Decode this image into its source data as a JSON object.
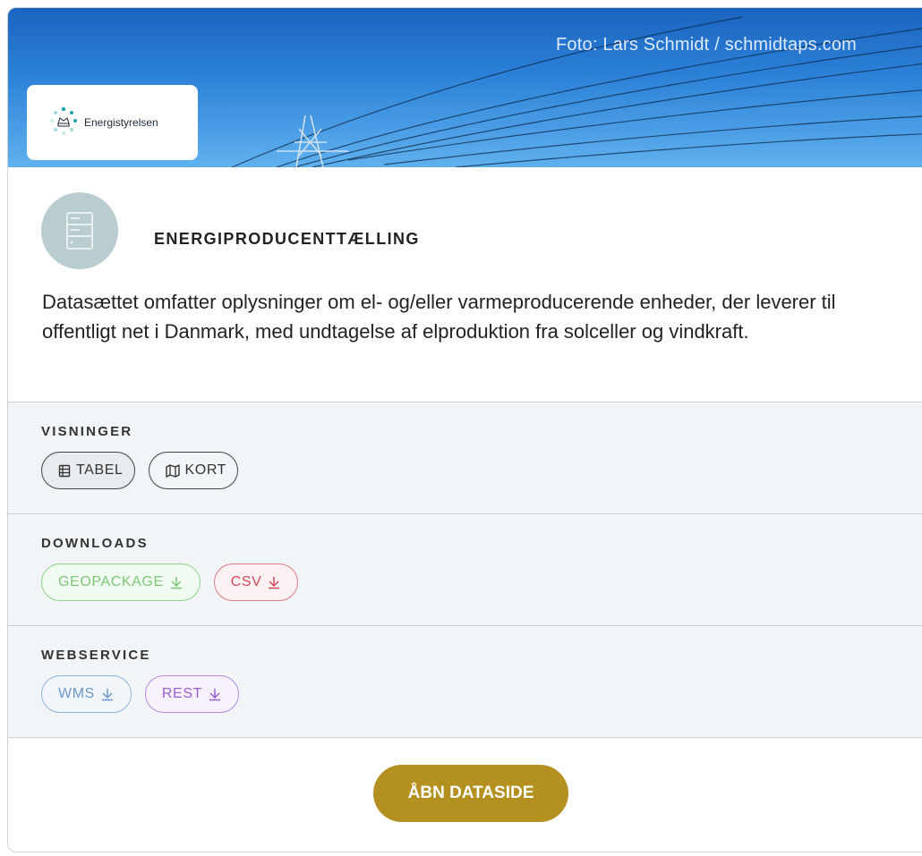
{
  "hero": {
    "photo_credit": "Foto: Lars Schmidt / schmidtaps.com",
    "logo_text": "Energistyrelsen"
  },
  "dataset": {
    "icon": "server-rack-icon",
    "title": "ENERGIPRODUCENTTÆLLING",
    "description": "Datasættet omfatter oplysninger om el- og/eller varmeproducerende enheder, der leverer til offentligt net i Danmark, med undtagelse af elproduktion fra solceller og vindkraft."
  },
  "sections": {
    "views": {
      "title": "VISNINGER",
      "items": [
        {
          "label": "TABEL",
          "icon": "table-icon"
        },
        {
          "label": "KORT",
          "icon": "map-icon"
        }
      ]
    },
    "downloads": {
      "title": "DOWNLOADS",
      "items": [
        {
          "label": "GEOPACKAGE",
          "icon": "download-icon",
          "color": "#7cc878"
        },
        {
          "label": "CSV",
          "icon": "download-icon",
          "color": "#d14b5c"
        }
      ]
    },
    "webservice": {
      "title": "WEBSERVICE",
      "items": [
        {
          "label": "WMS",
          "icon": "download-icon",
          "color": "#6a98cc"
        },
        {
          "label": "REST",
          "icon": "download-icon",
          "color": "#9a5fd4"
        }
      ]
    }
  },
  "footer": {
    "open_label": "ÅBN DATASIDE",
    "button_color": "#b3901f"
  }
}
